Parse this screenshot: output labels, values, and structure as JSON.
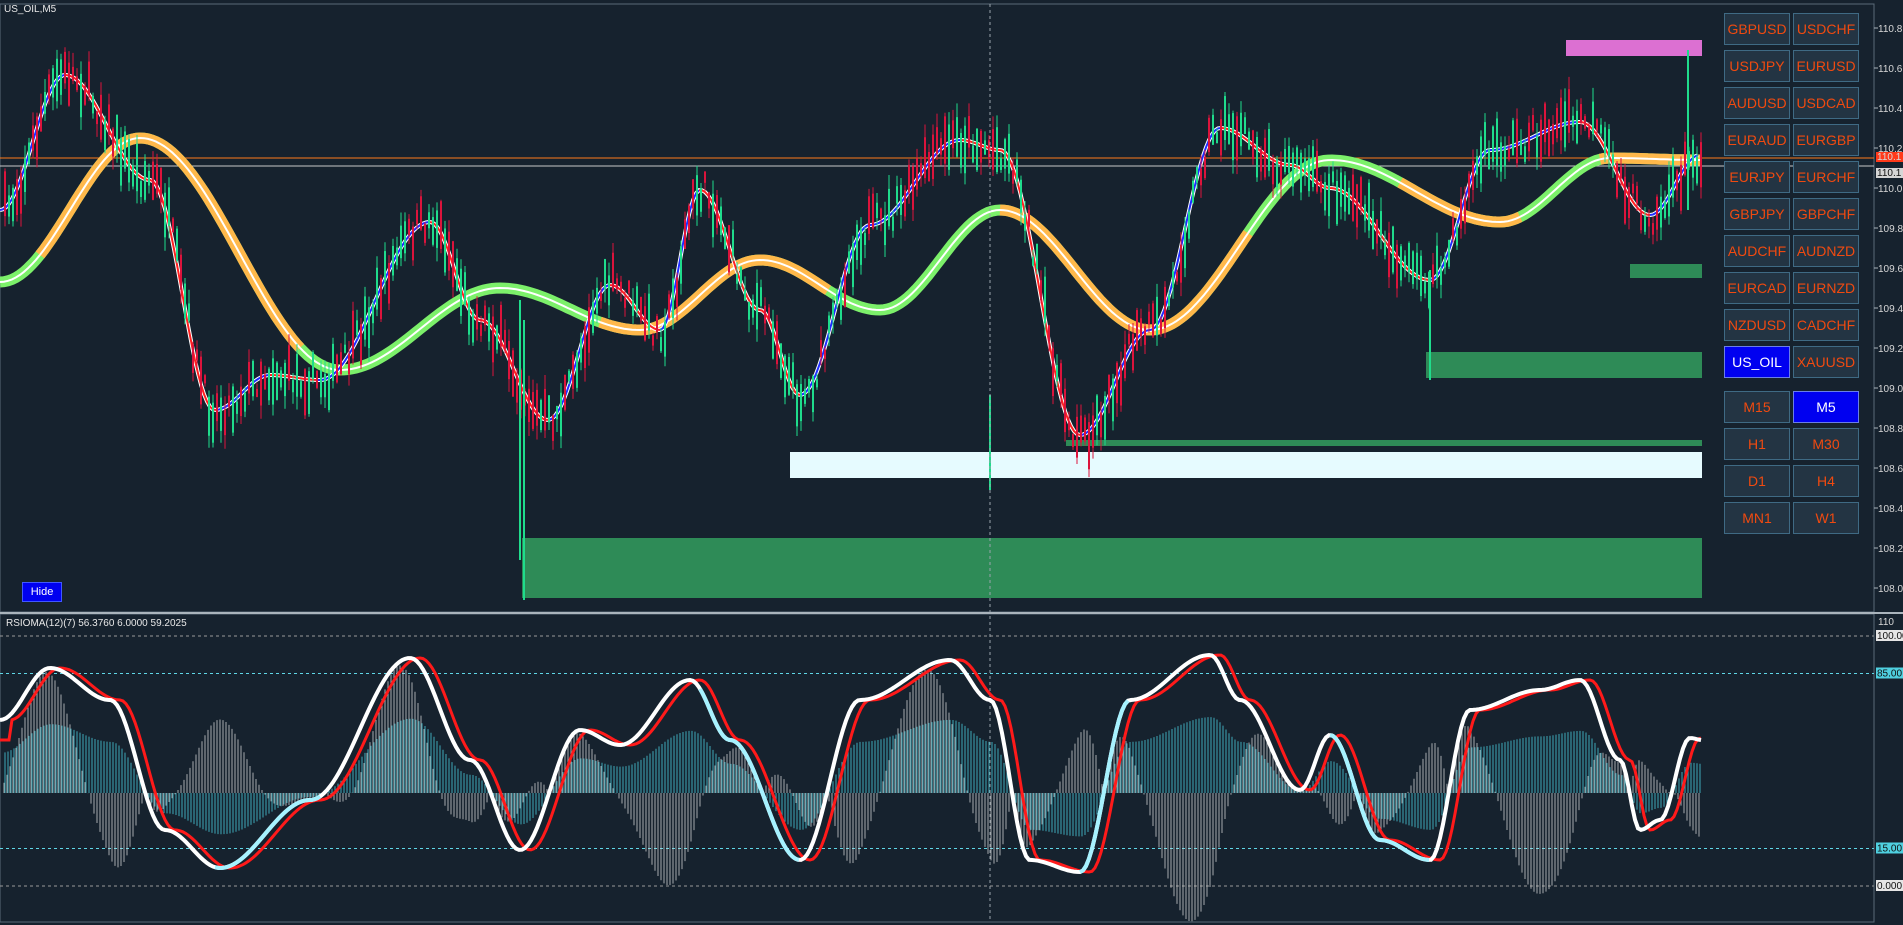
{
  "window": {
    "symbol_label": "US_OIL,M5",
    "hide_label": "Hide"
  },
  "price_axis": {
    "ticks": [
      "110.8",
      "110.6",
      "110.4",
      "110.2",
      "110.0",
      "109.8",
      "109.6",
      "109.4",
      "109.2",
      "109.0",
      "108.8",
      "108.6",
      "108.4",
      "108.2",
      "108.0"
    ],
    "ask_tag": "110.1",
    "bid_tag": "110.1",
    "ask_value": 110.15,
    "bid_value": 110.11
  },
  "indicator": {
    "label": "RSIOMA(12)(7) 56.3760 6.0000 59.2025",
    "axis_top": "110",
    "level_100": "100.00",
    "level_85": "85.00",
    "level_15": "15.00",
    "level_0": "0.000"
  },
  "symbols": [
    "GBPUSD",
    "USDCHF",
    "USDJPY",
    "EURUSD",
    "AUDUSD",
    "USDCAD",
    "EURAUD",
    "EURGBP",
    "EURJPY",
    "EURCHF",
    "GBPJPY",
    "GBPCHF",
    "AUDCHF",
    "AUDNZD",
    "EURCAD",
    "EURNZD",
    "NZDUSD",
    "CADCHF",
    "US_OIL",
    "XAUUSD"
  ],
  "active_symbol": "US_OIL",
  "timeframes": [
    "M15",
    "M5",
    "H1",
    "M30",
    "D1",
    "H4",
    "MN1",
    "W1"
  ],
  "active_timeframe": "M5",
  "colors": {
    "background": "#16222e",
    "bull_candle": "#1fdc8c",
    "bear_candle": "#dc143c",
    "fast_line_red": "#ff2020",
    "fast_line_blue": "#1e2bff",
    "slow_band_orange": "#ffb84a",
    "slow_band_green": "#7cf06a",
    "zone_green": "#2e8b57",
    "zone_white": "#e6fbff",
    "zone_pink": "#dc70d2",
    "rsi_red": "#ff1a1a",
    "rsi_white": "#ffffff",
    "rsi_cyan": "#a6f2ff",
    "hist_teal": "#3fa8b8",
    "hist_white": "#d8d8d8",
    "button_text": "#f04a10",
    "button_active": "#0000f0"
  }
}
